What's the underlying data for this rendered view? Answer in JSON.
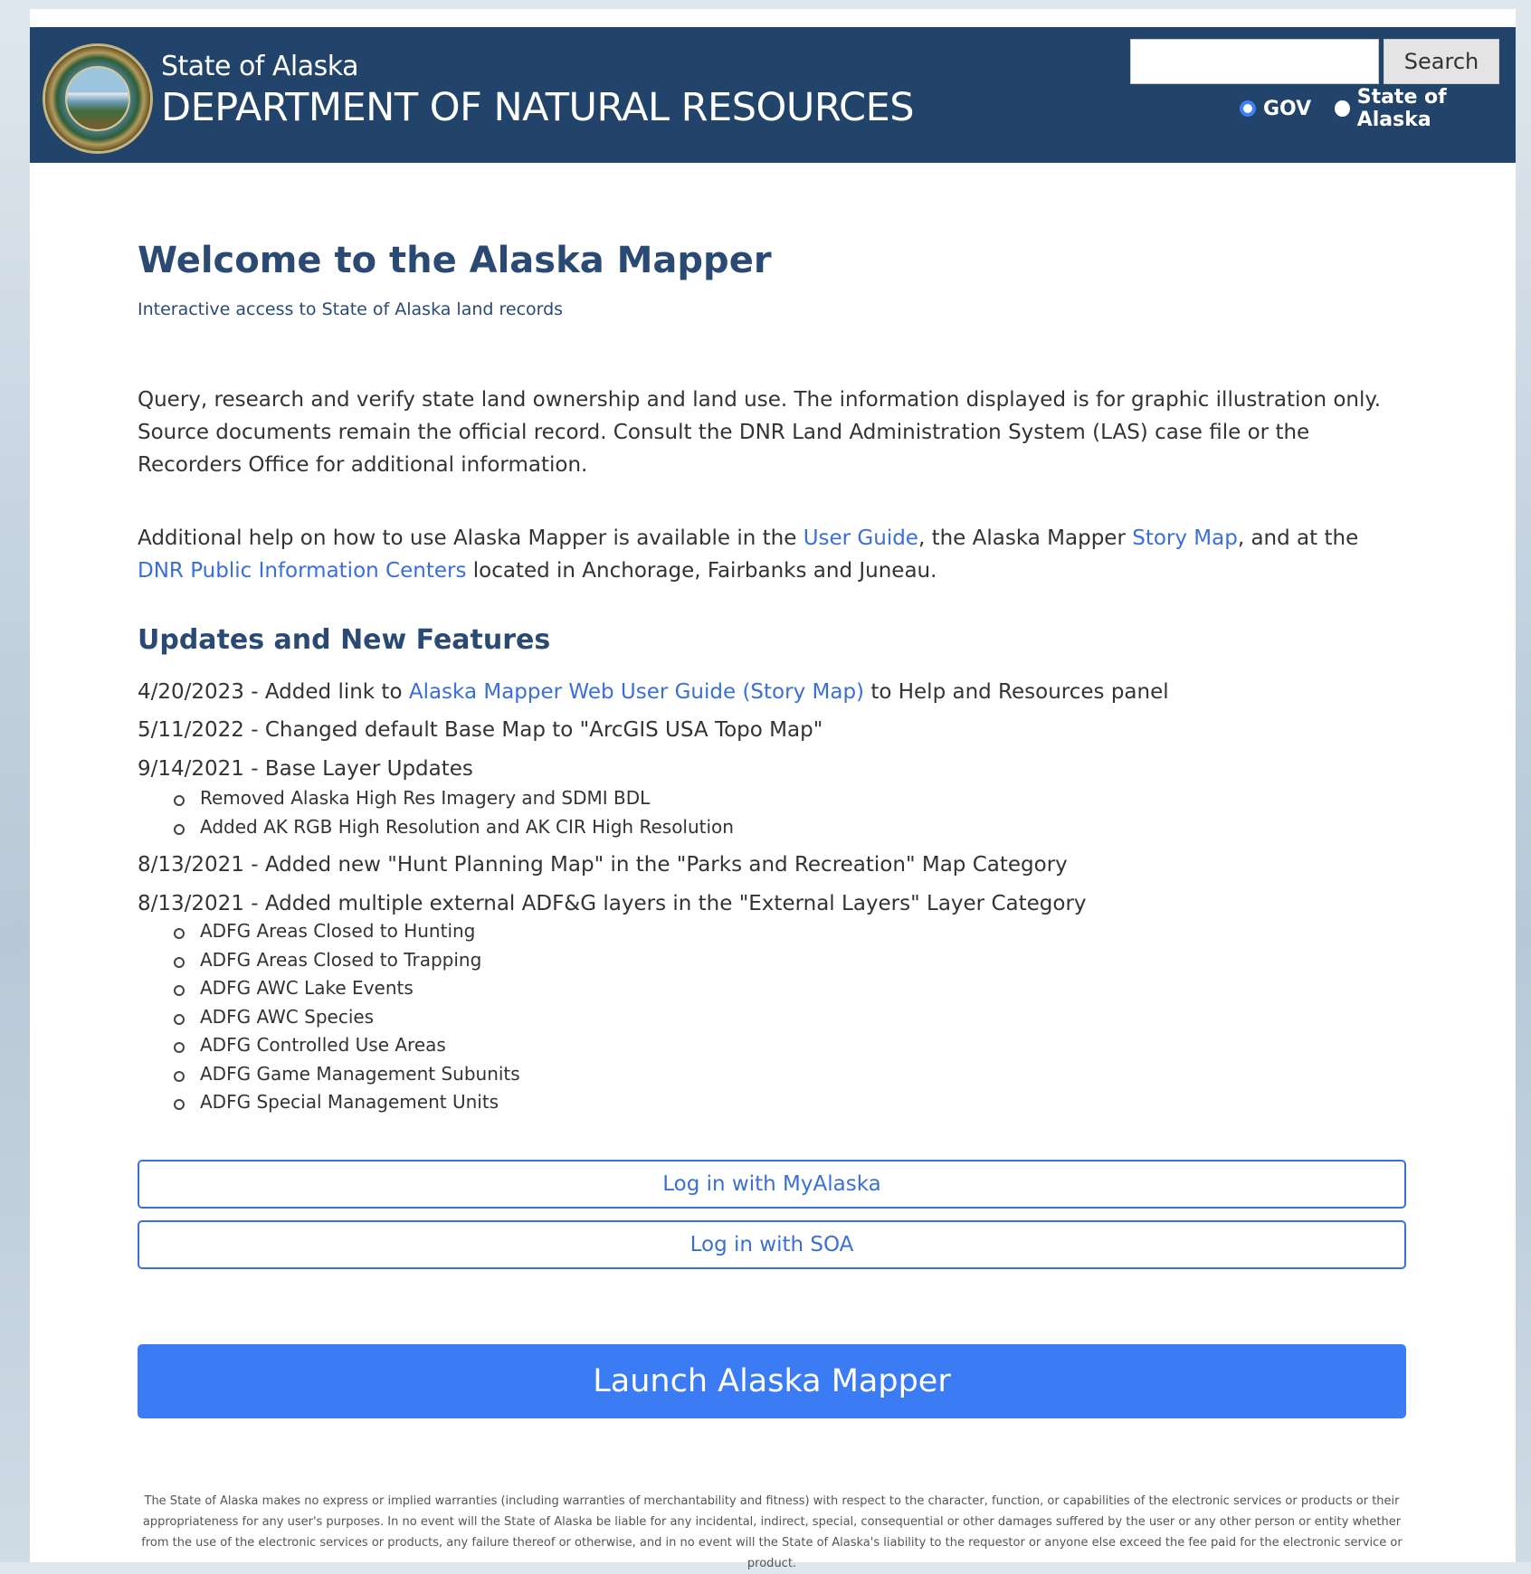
{
  "header": {
    "agency_small": "State of Alaska",
    "agency_big": "DEPARTMENT OF NATURAL RESOURCES",
    "search_placeholder": "",
    "search_button": "Search",
    "radio_gov": "GOV",
    "radio_state": "State of Alaska"
  },
  "main": {
    "title": "Welcome to the Alaska Mapper",
    "subtitle": "Interactive access to State of Alaska land records",
    "intro": "Query, research and verify state land ownership and land use. The information displayed is for graphic illustration only. Source documents remain the official record. Consult the DNR Land Administration System (LAS) case file or the Recorders Office for additional information.",
    "help": {
      "t1": "Additional help on how to use Alaska Mapper is available in the ",
      "link_user_guide": "User Guide",
      "t2": ", the Alaska Mapper ",
      "link_story_map": "Story Map",
      "t3": ", and at the ",
      "link_dnr": "DNR Public Information Centers",
      "t4": " located in Anchorage, Fairbanks and Juneau."
    },
    "updates_heading": "Updates and New Features",
    "updates": {
      "u1_a": "4/20/2023 - Added link to ",
      "u1_link": "Alaska Mapper Web User Guide (Story Map)",
      "u1_b": " to Help and Resources panel",
      "u2": "5/11/2022 - Changed default Base Map to \"ArcGIS USA Topo Map\"",
      "u3": "9/14/2021 - Base Layer Updates",
      "u3_items": [
        "Removed Alaska High Res Imagery and SDMI BDL",
        "Added AK RGB High Resolution and AK CIR High Resolution"
      ],
      "u4": "8/13/2021 - Added new \"Hunt Planning Map\" in the \"Parks and Recreation\" Map Category",
      "u5": "8/13/2021 - Added multiple external ADF&G layers in the \"External Layers\" Layer Category",
      "u5_items": [
        "ADFG Areas Closed to Hunting",
        "ADFG Areas Closed to Trapping",
        "ADFG AWC Lake Events",
        "ADFG AWC Species",
        "ADFG Controlled Use Areas",
        "ADFG Game Management Subunits",
        "ADFG Special Management Units"
      ]
    },
    "login_myalaska": "Log in with MyAlaska",
    "login_soa": "Log in with SOA",
    "launch": "Launch Alaska Mapper",
    "disclaimer": "The State of Alaska makes no express or implied warranties (including warranties of merchantability and fitness) with respect to the character, function, or capabilities of the electronic services or products or their appropriateness for any user's purposes. In no event will the State of Alaska be liable for any incidental, indirect, special, consequential or other damages suffered by the user or any other person or entity whether from the use of the electronic services or products, any failure thereof or otherwise, and in no event will the State of Alaska's liability to the requestor or anyone else exceed the fee paid for the electronic service or product."
  }
}
